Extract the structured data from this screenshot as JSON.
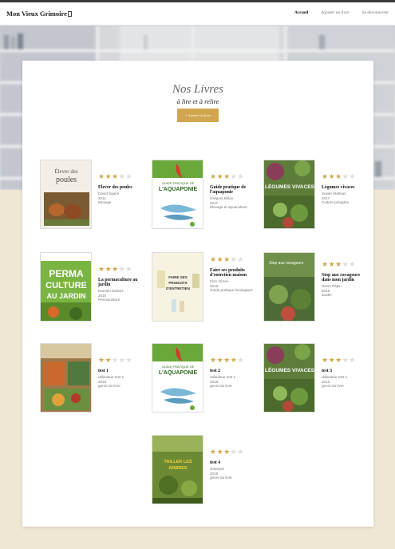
{
  "nav": {
    "brand": "Mon Vieux Grimoire",
    "links": [
      {
        "label": "Accueil",
        "active": true
      },
      {
        "label": "Ajouter un livre",
        "active": false
      },
      {
        "label": "Se déconnecter",
        "active": false
      }
    ]
  },
  "header": {
    "title": "Nos Livres",
    "subtitle": "à lire et à relire",
    "add_button": "+ Ajouter un livre"
  },
  "colors": {
    "accent": "#d1a64f",
    "star_on": "#d4a84e",
    "star_off": "#dcdcdc",
    "background": "#efe6d3"
  },
  "books": [
    {
      "title": "Elever des poules",
      "rating": 3,
      "author": "David Squire",
      "year": "2011",
      "genre": "Elevage",
      "cover": "poules",
      "cover_text": [
        "Élever des",
        "poules"
      ]
    },
    {
      "title": "Guide pratique de l'aquaponie",
      "rating": 3,
      "author": "Grégory Billon",
      "year": "2017",
      "genre": "Élevage et aquaculture",
      "cover": "aqua",
      "cover_text": [
        "GUIDE PRATIQUE DE",
        "L'AQUAPONIE"
      ]
    },
    {
      "title": "Légumes vivaces",
      "rating": 3,
      "author": "Xavier Mathias",
      "year": "2017",
      "genre": "Culture potagère",
      "cover": "leg",
      "cover_text": [
        "LÉGUMES VIVACES"
      ]
    },
    {
      "title": "La permaculture au jardin",
      "rating": 3,
      "author": "Damien Dekarz",
      "year": "2016",
      "genre": "Permaculture",
      "cover": "perma",
      "cover_text": [
        "PERMA",
        "CULTURE",
        "AU JARDIN"
      ]
    },
    {
      "title": "Faire ses produits d'entretien maison",
      "rating": 3,
      "author": "Fern Green",
      "year": "2019",
      "genre": "Guide pratique écologique",
      "cover": "prod",
      "cover_text": [
        "FAIRE SES",
        "PRODUITS",
        "D'ENTRETIEN"
      ]
    },
    {
      "title": "Stop aux ravageurs dans mon jardin",
      "rating": 3,
      "author": "Denis Pépin",
      "year": "2016",
      "genre": "Jardin",
      "cover": "stop",
      "cover_text": [
        "Stop aux ravageurs"
      ]
    },
    {
      "title": "test 1",
      "rating": 2,
      "author": "utilisateur test 1",
      "year": "2018",
      "genre": "genre du livre",
      "cover": "test1",
      "cover_text": []
    },
    {
      "title": "test 2",
      "rating": 4,
      "author": "utilisateur test 1",
      "year": "2018",
      "genre": "genre du livre",
      "cover": "aqua",
      "cover_text": [
        "GUIDE PRATIQUE DE",
        "L'AQUAPONIE"
      ]
    },
    {
      "title": "test 3",
      "rating": 3,
      "author": "utilisateur test 1",
      "year": "2018",
      "genre": "genre du livre",
      "cover": "leg",
      "cover_text": [
        "LÉGUMES VIVACES"
      ]
    },
    {
      "title": "test 4",
      "rating": 3,
      "author": "vidnejuin",
      "year": "2018",
      "genre": "genre du livre",
      "cover": "test4",
      "cover_text": [
        "TAILLER LES",
        "ARBRES"
      ]
    }
  ]
}
